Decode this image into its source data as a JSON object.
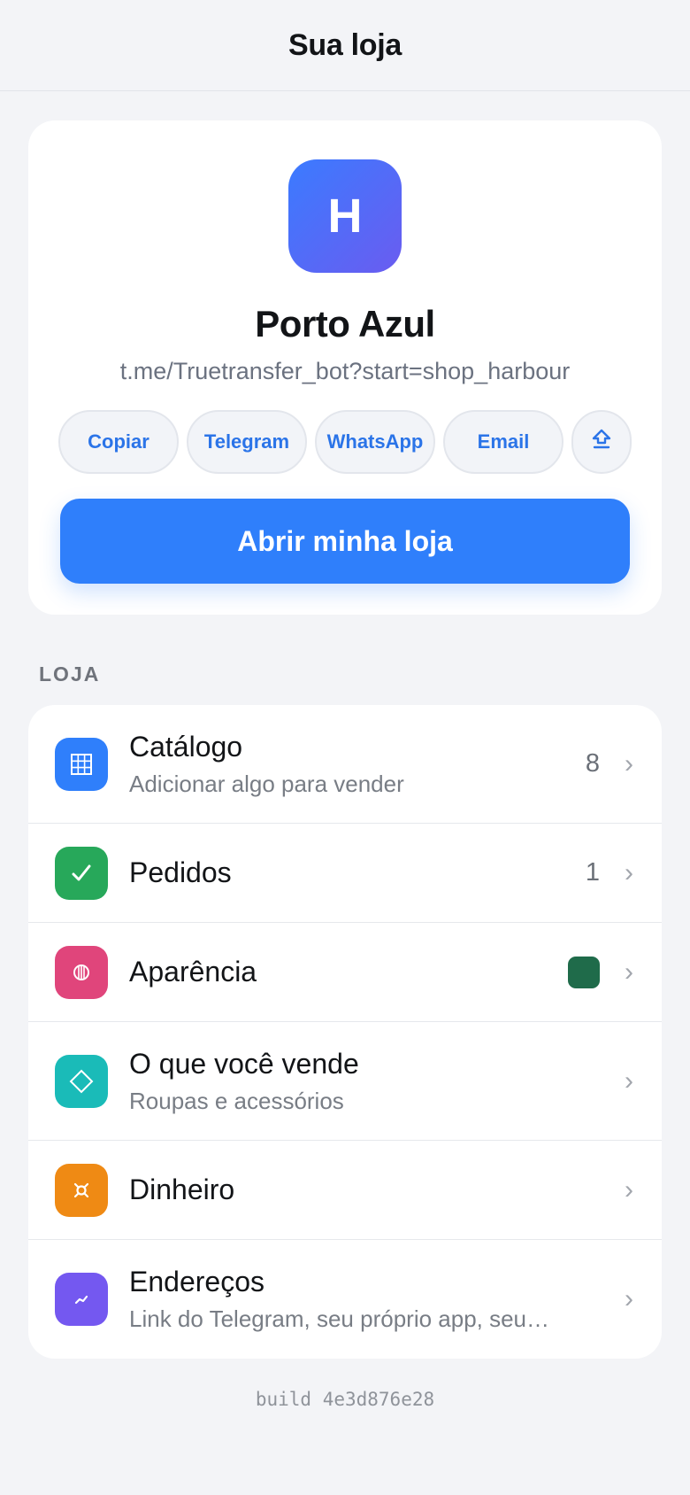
{
  "header": {
    "title": "Sua loja"
  },
  "shop": {
    "logo_letter": "H",
    "name": "Porto Azul",
    "link": "t.me/Truetransfer_bot?start=shop_harbour",
    "share": {
      "copy": "Copiar",
      "telegram": "Telegram",
      "whatsapp": "WhatsApp",
      "email": "Email",
      "more_icon": "share-icon"
    },
    "open_button": "Abrir minha loja"
  },
  "section": {
    "label": "LOJA"
  },
  "rows": [
    {
      "title": "Catálogo",
      "subtitle": "Adicionar algo para vender",
      "count": "8",
      "icon": "grid-icon",
      "color": "#2f7ffb"
    },
    {
      "title": "Pedidos",
      "count": "1",
      "icon": "check-icon",
      "color": "#27a85a"
    },
    {
      "title": "Aparência",
      "icon": "palette-icon",
      "color": "#e0457b",
      "swatch_color": "#1f6b4a"
    },
    {
      "title": "O que você vende",
      "subtitle": "Roupas e acessórios",
      "icon": "diamond-icon",
      "color": "#1abbb8"
    },
    {
      "title": "Dinheiro",
      "icon": "currency-icon",
      "color": "#ef8a14"
    },
    {
      "title": "Endereços",
      "subtitle": "Link do Telegram, seu próprio app, seu…",
      "icon": "link-icon",
      "color": "#7458f0"
    }
  ],
  "footer": {
    "build": "build 4e3d876e28"
  },
  "colors": {
    "accent": "#2f7ffb",
    "background": "#f3f4f7"
  }
}
